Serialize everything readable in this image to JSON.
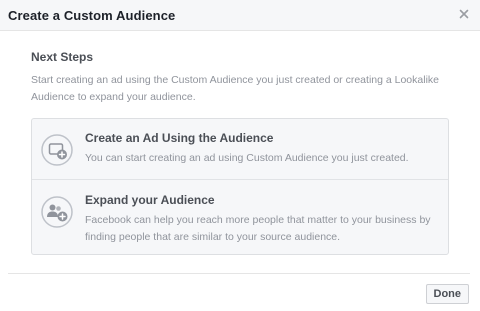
{
  "dialog": {
    "title": "Create a Custom Audience",
    "close_icon": "close-icon"
  },
  "next_steps": {
    "heading": "Next Steps",
    "description": "Start creating an ad using the Custom Audience you just created or creating a Lookalike Audience to expand your audience."
  },
  "options": [
    {
      "icon": "add-ad-icon",
      "title": "Create an Ad Using the Audience",
      "description": "You can start creating an ad using Custom Audience you just created."
    },
    {
      "icon": "add-people-icon",
      "title": "Expand your Audience",
      "description": "Facebook can help you reach more people that matter to your business by finding people that are similar to your source audience."
    }
  ],
  "footer": {
    "done_label": "Done"
  }
}
